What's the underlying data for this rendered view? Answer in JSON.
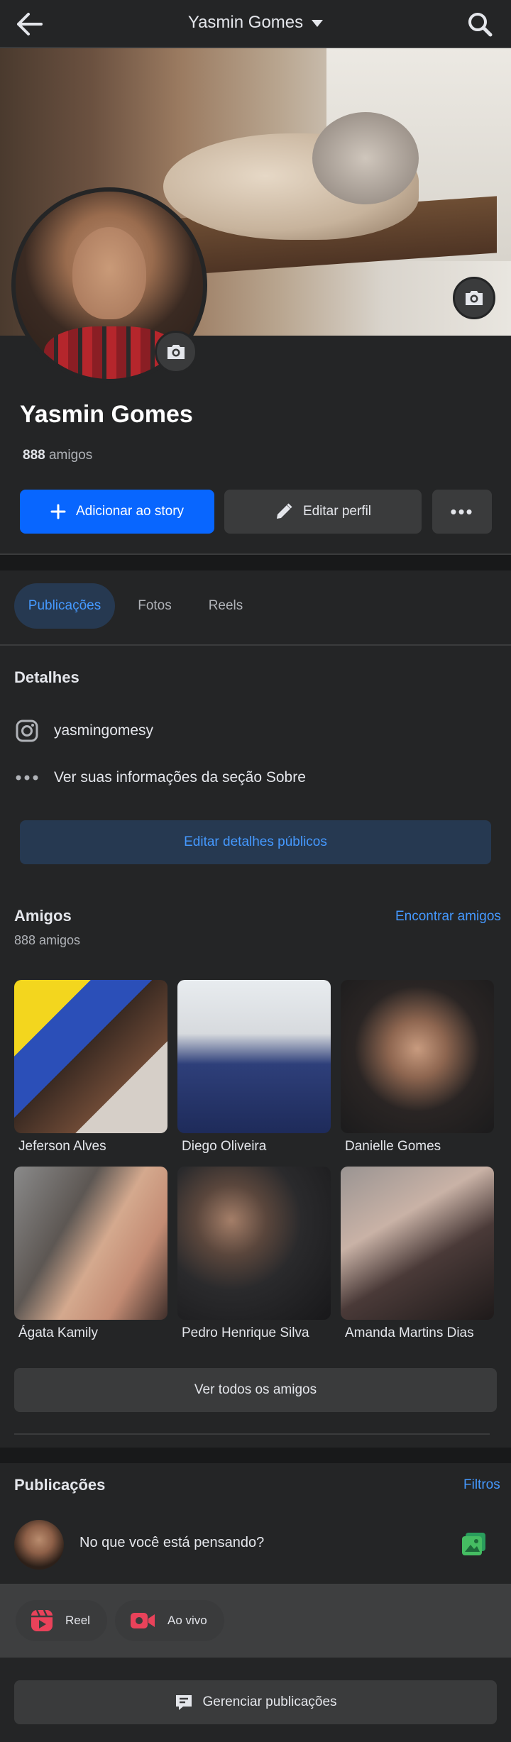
{
  "header": {
    "title": "Yasmin Gomes"
  },
  "profile": {
    "name": "Yasmin Gomes",
    "friends_number": "888",
    "friends_word": "amigos"
  },
  "actions": {
    "story_label": "Adicionar ao story",
    "edit_label": "Editar perfil",
    "more_label": "•••"
  },
  "tabs": [
    {
      "label": "Publicações",
      "active": true
    },
    {
      "label": "Fotos",
      "active": false
    },
    {
      "label": "Reels",
      "active": false
    }
  ],
  "details": {
    "title": "Detalhes",
    "instagram": "yasmingomesy",
    "about": "Ver suas informações da seção Sobre",
    "edit_public": "Editar detalhes públicos"
  },
  "friends": {
    "title": "Amigos",
    "count_text": "888 amigos",
    "find_link": "Encontrar amigos",
    "list": [
      {
        "name": "Jeferson Alves"
      },
      {
        "name": "Diego Oliveira"
      },
      {
        "name": "Danielle Gomes"
      },
      {
        "name": "Ágata Kamily"
      },
      {
        "name": "Pedro Henrique Silva"
      },
      {
        "name": "Amanda Martins Dias"
      }
    ],
    "see_all": "Ver todos os amigos"
  },
  "posts": {
    "title": "Publicações",
    "filters": "Filtros",
    "composer_placeholder": "No que você está pensando?",
    "reel_label": "Reel",
    "live_label": "Ao vivo",
    "manage_label": "Gerenciar publicações"
  },
  "colors": {
    "background": "#242526",
    "accent_blue": "#0866ff",
    "link_blue": "#4599ff",
    "secondary_button": "#3a3b3c"
  }
}
